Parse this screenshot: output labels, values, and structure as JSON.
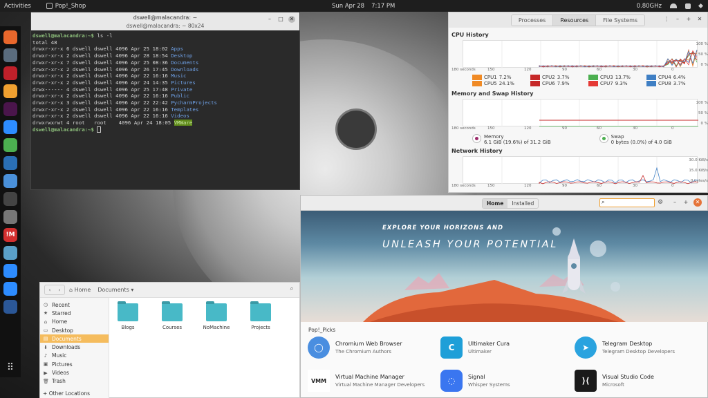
{
  "topbar": {
    "activities": "Activities",
    "app": "Pop!_Shop",
    "date": "Sun Apr 28",
    "time": "7:17 PM",
    "cpu": "0.80GHz"
  },
  "dock": {
    "items": [
      {
        "name": "firefox-icon",
        "color": "#e8672c",
        "glyph": ""
      },
      {
        "name": "files-icon",
        "color": "#5a6c7e",
        "glyph": ""
      },
      {
        "name": "terminal-icon",
        "color": "#c0202a",
        "glyph": ""
      },
      {
        "name": "archive-icon",
        "color": "#f0a030",
        "glyph": ""
      },
      {
        "name": "slack-icon",
        "color": "#4a154b",
        "glyph": ""
      },
      {
        "name": "zoom-icon",
        "color": "#2d8cff",
        "glyph": ""
      },
      {
        "name": "globe-icon",
        "color": "#4caf50",
        "glyph": ""
      },
      {
        "name": "virtualbox-icon",
        "color": "#2a6fb5",
        "glyph": ""
      },
      {
        "name": "network-icon",
        "color": "#4a90d9",
        "glyph": ""
      },
      {
        "name": "monitor-icon",
        "color": "#444444",
        "glyph": ""
      },
      {
        "name": "disk-icon",
        "color": "#777777",
        "glyph": ""
      },
      {
        "name": "app-m-icon",
        "color": "#d32f2f",
        "glyph": "!M"
      },
      {
        "name": "vm-icon",
        "color": "#5aa0c8",
        "glyph": ""
      },
      {
        "name": "cloud-icon",
        "color": "#2d8cff",
        "glyph": ""
      },
      {
        "name": "zoom2-icon",
        "color": "#2d8cff",
        "glyph": ""
      },
      {
        "name": "document-icon",
        "color": "#2b5797",
        "glyph": ""
      }
    ]
  },
  "terminal": {
    "title": "dswell@malacandra: ~",
    "subtitle": "dswell@malacandra: ~ 80x24",
    "prompt": "dswell@malacandra:~$",
    "command": " ls -l",
    "total": "total 48",
    "rows": [
      {
        "meta": "drwxr-xr-x 6 dswell dswell 4096 Apr 25 18:02 ",
        "name": "Apps",
        "hl": false
      },
      {
        "meta": "drwxr-xr-x 2 dswell dswell 4096 Apr 28 18:54 ",
        "name": "Desktop",
        "hl": false
      },
      {
        "meta": "drwxr-xr-x 7 dswell dswell 4096 Apr 25 08:36 ",
        "name": "Documents",
        "hl": false
      },
      {
        "meta": "drwxr-xr-x 2 dswell dswell 4096 Apr 26 17:45 ",
        "name": "Downloads",
        "hl": false
      },
      {
        "meta": "drwxr-xr-x 2 dswell dswell 4096 Apr 22 16:16 ",
        "name": "Music",
        "hl": false
      },
      {
        "meta": "drwxr-xr-x 2 dswell dswell 4096 Apr 24 14:35 ",
        "name": "Pictures",
        "hl": false
      },
      {
        "meta": "drwx------ 4 dswell dswell 4096 Apr 25 17:48 ",
        "name": "Private",
        "hl": false
      },
      {
        "meta": "drwxr-xr-x 2 dswell dswell 4096 Apr 22 16:16 ",
        "name": "Public",
        "hl": false
      },
      {
        "meta": "drwxr-xr-x 3 dswell dswell 4096 Apr 22 22:42 ",
        "name": "PycharmProjects",
        "hl": false
      },
      {
        "meta": "drwxr-xr-x 2 dswell dswell 4096 Apr 22 16:16 ",
        "name": "Templates",
        "hl": false
      },
      {
        "meta": "drwxr-xr-x 2 dswell dswell 4096 Apr 22 16:16 ",
        "name": "Videos",
        "hl": false
      },
      {
        "meta": "drwxrwxrwt 4 root   root    4096 Apr 24 18:05 ",
        "name": "VMWare",
        "hl": true
      }
    ]
  },
  "sysmon": {
    "tabs": [
      "Processes",
      "Resources",
      "File Systems"
    ],
    "active_tab": 1,
    "cpu_title": "CPU History",
    "mem_title": "Memory and Swap History",
    "net_title": "Network History",
    "x_ticks": [
      "180 seconds",
      "150",
      "120",
      "90",
      "60",
      "30",
      "0"
    ],
    "cpu_y": [
      "100 %",
      "50 %",
      "0 %"
    ],
    "mem_y": [
      "100 %",
      "50 %",
      "0 %"
    ],
    "net_y": [
      "30.0 KiB/s",
      "15.0 KiB/s",
      "0 bytes/s"
    ],
    "cpus": [
      {
        "label": "CPU1",
        "value": "7.2%",
        "color": "#f08a24"
      },
      {
        "label": "CPU2",
        "value": "3.7%",
        "color": "#c62828"
      },
      {
        "label": "CPU3",
        "value": "13.7%",
        "color": "#4caf50"
      },
      {
        "label": "CPU4",
        "value": "6.4%",
        "color": "#3f7fc4"
      },
      {
        "label": "CPU5",
        "value": "24.1%",
        "color": "#f08a24"
      },
      {
        "label": "CPU6",
        "value": "7.9%",
        "color": "#c62828"
      },
      {
        "label": "CPU7",
        "value": "9.3%",
        "color": "#e53935"
      },
      {
        "label": "CPU8",
        "value": "3.7%",
        "color": "#3f7fc4"
      }
    ],
    "memory_label": "Memory",
    "memory_value": "6.1 GiB (19.6%) of 31.2 GiB",
    "swap_label": "Swap",
    "swap_value": "0 bytes (0.0%) of 4.0 GiB"
  },
  "files": {
    "crumb_home": "Home",
    "crumb_current": "Documents",
    "sidebar": [
      {
        "label": "Recent",
        "icon": "◷"
      },
      {
        "label": "Starred",
        "icon": "★"
      },
      {
        "label": "Home",
        "icon": "⌂"
      },
      {
        "label": "Desktop",
        "icon": "▭"
      },
      {
        "label": "Documents",
        "icon": "▤",
        "active": true
      },
      {
        "label": "Downloads",
        "icon": "⬇"
      },
      {
        "label": "Music",
        "icon": "♪"
      },
      {
        "label": "Pictures",
        "icon": "▣"
      },
      {
        "label": "Videos",
        "icon": "▶"
      },
      {
        "label": "Trash",
        "icon": "🗑"
      }
    ],
    "other_locations": "Other Locations",
    "folders": [
      "Blogs",
      "Courses",
      "NoMachine",
      "Projects"
    ]
  },
  "shop": {
    "tabs": [
      "Home",
      "Installed"
    ],
    "banner_line1": "EXPLORE YOUR HORIZONS AND",
    "banner_line2": "UNLEASH YOUR POTENTIAL",
    "picks_title": "Pop!_Picks",
    "picks": [
      {
        "name": "Chromium Web Browser",
        "dev": "The Chromium Authors",
        "color": "#4a8ee0",
        "glyph": "◯"
      },
      {
        "name": "Ultimaker Cura",
        "dev": "Ultimaker",
        "color": "#1e9fd8",
        "glyph": "C"
      },
      {
        "name": "Telegram Desktop",
        "dev": "Telegram Desktop Developers",
        "color": "#2aa3df",
        "glyph": "➤"
      },
      {
        "name": "Virtual Machine Manager",
        "dev": "Virtual Machine Manager Developers",
        "color": "#ffffff",
        "glyph": "VMM"
      },
      {
        "name": "Signal",
        "dev": "Whisper Systems",
        "color": "#3a76f0",
        "glyph": "◌"
      },
      {
        "name": "Visual Studio Code",
        "dev": "Microsoft",
        "color": "#1a1a1a",
        "glyph": "⟩⟨"
      }
    ]
  }
}
